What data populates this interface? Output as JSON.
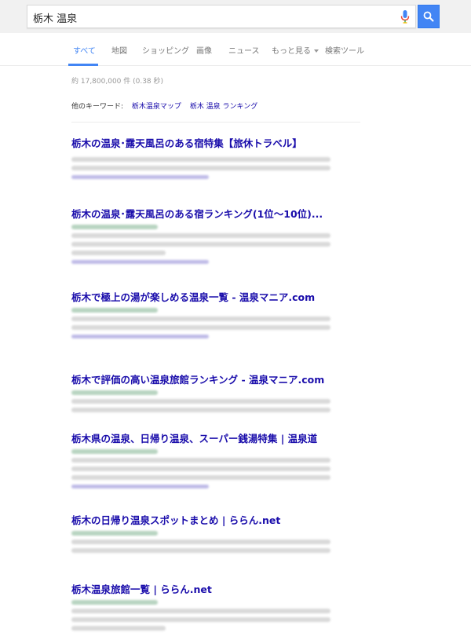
{
  "search": {
    "query": "栃木 温泉",
    "button_color": "#4285f4"
  },
  "tabs": [
    {
      "label": "すべて",
      "active": true
    },
    {
      "label": "地図"
    },
    {
      "label": "ショッピング"
    },
    {
      "label": "画像"
    },
    {
      "label": "ニュース"
    },
    {
      "label": "もっと見る"
    },
    {
      "label": "検索ツール"
    }
  ],
  "stats": "約 17,800,000 件 (0.38 秒)",
  "keywords": {
    "label": "他のキーワード:",
    "links": [
      "栃木温泉マップ",
      "栃木 温泉 ランキング"
    ]
  },
  "results": [
    {
      "title": "栃木の温泉･露天風呂のある宿特集【旅休トラベル】"
    },
    {
      "title": "栃木の温泉･露天風呂のある宿ランキング(1位～10位)..."
    },
    {
      "title": "栃木で極上の湯が楽しめる温泉一覧 - 温泉マニア.com"
    },
    {
      "title": "栃木で評価の高い温泉旅館ランキング - 温泉マニア.com"
    },
    {
      "title": "栃木県の温泉、日帰り温泉、スーパー銭湯特集 | 温泉道"
    },
    {
      "title": "栃木の日帰り温泉スポットまとめ | ららん.net"
    },
    {
      "title": "栃木温泉旅館一覧 | ららん.net"
    }
  ],
  "colors": {
    "link": "#1a0dab",
    "url": "#006621",
    "accent": "#4285f4"
  }
}
